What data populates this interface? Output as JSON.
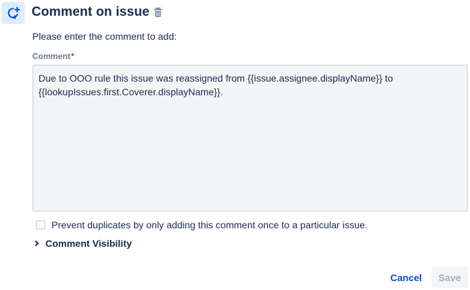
{
  "header": {
    "icon": "comment-add-icon",
    "title": "Comment on issue",
    "delete_icon": "trash-icon"
  },
  "form": {
    "instructions": "Please enter the comment to add:",
    "comment_label": "Comment",
    "required_marker": "*",
    "comment_value": "Due to OOO rule this issue was reassigned from {{issue.assignee.displayName}} to {{lookupIssues.first.Coverer.displayName}}.",
    "prevent_duplicates_label": "Prevent duplicates by only adding this comment once to a particular issue.",
    "prevent_duplicates_checked": false,
    "visibility_label": "Comment Visibility",
    "visibility_icon": "chevron-right-icon"
  },
  "actions": {
    "cancel_label": "Cancel",
    "save_label": "Save"
  },
  "colors": {
    "accent": "#0052cc",
    "icon_bg": "#deebff",
    "required": "#de350b",
    "disabled_text": "#a5adba"
  }
}
